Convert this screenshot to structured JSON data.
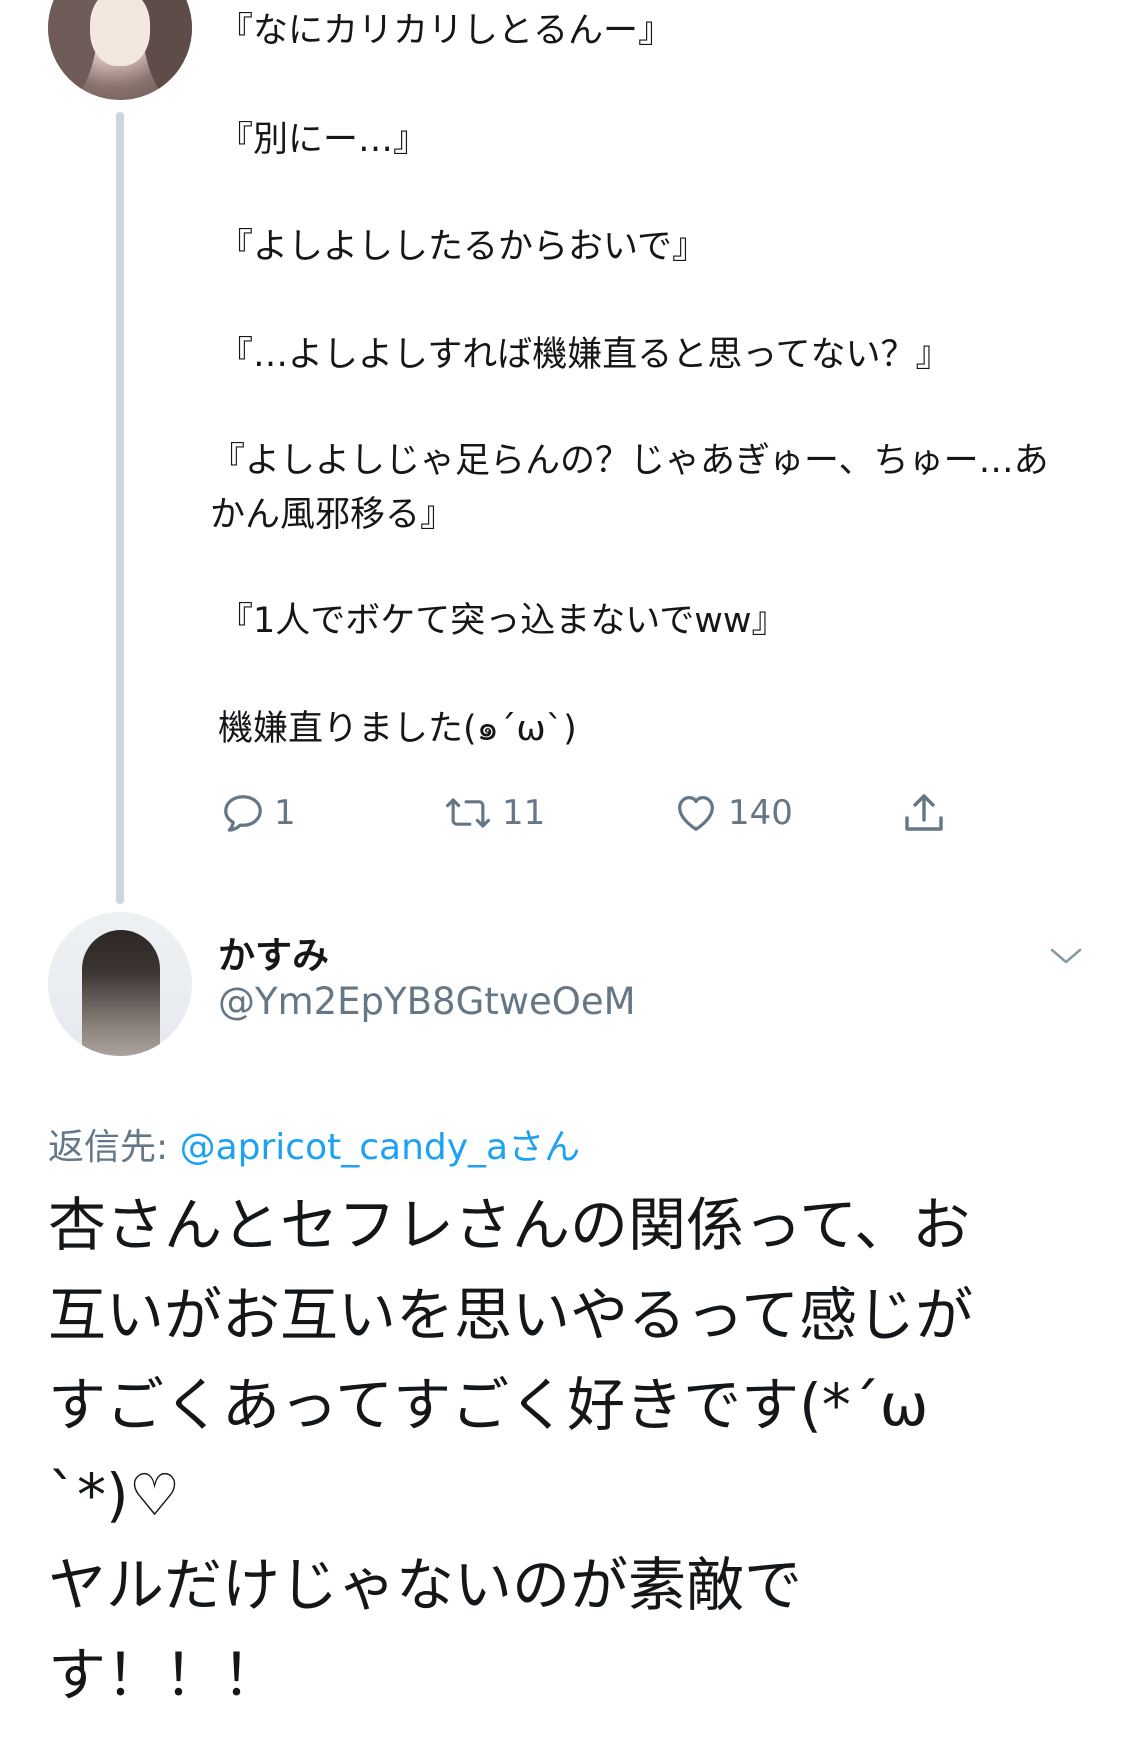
{
  "thread_tweet": {
    "lines": [
      "『なにカリカリしとるんー』",
      "『別にー…』",
      "『よしよししたるからおいで』",
      "『…よしよしすれば機嫌直ると思ってない？』",
      "『よしよしじゃ足らんの？じゃあぎゅー、ちゅー…あかん風邪移る』",
      "『1人でボケて突っ込まないでww』",
      "機嫌直りました(๑ˊωˋ)"
    ],
    "actions": {
      "reply_count": "1",
      "retweet_count": "11",
      "like_count": "140"
    }
  },
  "reply_tweet": {
    "display_name": "かすみ",
    "handle": "@Ym2EpYB8GtweOeM",
    "reply_to_label": "返信先: ",
    "reply_to_mention": "@apricot_candy_aさん",
    "text_lines": [
      "杏さんとセフレさんの関係って、お",
      "互いがお互いを思いやるって感じが",
      "すごくあってすごく好きです(*´ω",
      "`*)♡",
      "ヤルだけじゃないのが素敵で",
      "す！！！"
    ]
  },
  "icons": {
    "reply": "reply-icon",
    "retweet": "retweet-icon",
    "like": "heart-icon",
    "share": "share-icon",
    "more": "chevron-down-icon"
  },
  "colors": {
    "text": "#14171a",
    "secondary": "#657786",
    "link": "#1da1f2",
    "thread_line": "#ccd6dd"
  }
}
